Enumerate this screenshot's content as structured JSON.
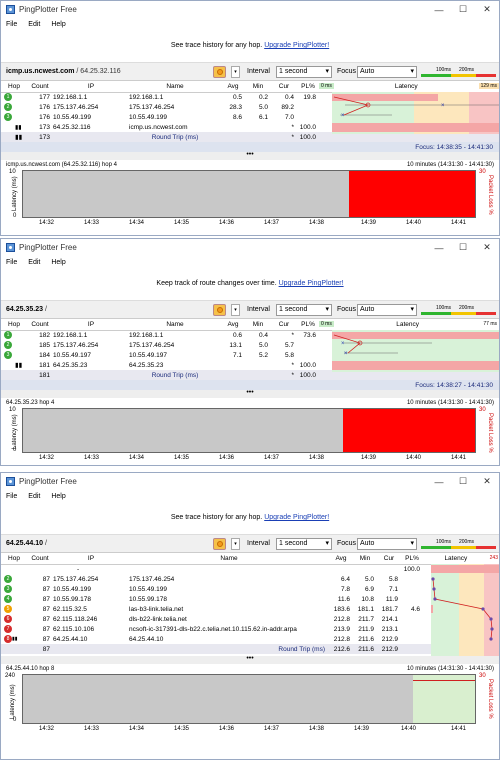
{
  "app_title": "PingPlotter Free",
  "menus": [
    "File",
    "Edit",
    "Help"
  ],
  "window_buttons": [
    "—",
    "☐",
    "✕"
  ],
  "upgrade_link": "Upgrade PingPlotter!",
  "interval_label": "Interval",
  "interval_value": "1 second",
  "focus_label": "Focus",
  "focus_value": "Auto",
  "scale": {
    "t1": "100ms",
    "t2": "200ms"
  },
  "headers": {
    "hop": "Hop",
    "count": "Count",
    "ip": "IP",
    "name": "Name",
    "avg": "Avg",
    "min": "Min",
    "cur": "Cur",
    "pl": "PL%",
    "latency": "Latency"
  },
  "round_trip": "Round Trip (ms)",
  "colors": {
    "good": "#3aa83a",
    "warn": "#f0a000",
    "bad": "#d62c2c",
    "red_fill": "#ff0000"
  },
  "windows": [
    {
      "banner": "See trace history for any hop.",
      "target_host": "icmp.us.ncwest.com",
      "target_ip": "/ 64.25.32.116",
      "lat_min_label": "0 ms",
      "lat_max_label": "129 ms",
      "hops": [
        {
          "hop": "1",
          "count": "177",
          "ip": "192.168.1.1",
          "name": "192.168.1.1",
          "avg": "0.5",
          "min": "0.2",
          "cur": "0.4",
          "pl": "19.8",
          "status": "good"
        },
        {
          "hop": "2",
          "count": "176",
          "ip": "175.137.46.254",
          "name": "175.137.46.254",
          "avg": "28.3",
          "min": "5.0",
          "cur": "89.2",
          "pl": "",
          "status": "good"
        },
        {
          "hop": "3",
          "count": "176",
          "ip": "10.55.49.199",
          "name": "10.55.49.199",
          "avg": "8.6",
          "min": "6.1",
          "cur": "7.0",
          "pl": "",
          "status": "good"
        },
        {
          "hop": "4",
          "count": "173",
          "ip": "64.25.32.116",
          "name": "icmp.us.ncwest.com",
          "avg": "",
          "min": "",
          "cur": "*",
          "pl": "100.0",
          "status": "none"
        }
      ],
      "summary": {
        "count": "173",
        "avg": "",
        "min": "",
        "cur": "*",
        "pl": "100.0"
      },
      "focus_text": "Focus: 14:38:35 - 14:41:30",
      "graph_title": "icmp.us.ncwest.com (64.25.32.116) hop 4",
      "graph_range": "10 minutes (14:31:30 - 14:41:30)",
      "y_top": "10",
      "y_bottom": "0",
      "right_top": "30",
      "x_ticks": [
        "14:32",
        "14:33",
        "14:34",
        "14:35",
        "14:36",
        "14:37",
        "14:38",
        "14:39",
        "14:40",
        "14:41"
      ]
    },
    {
      "banner": "Keep track of route changes over time.",
      "target_host": "64.25.35.23",
      "target_ip": "/",
      "lat_min_label": "0 ms",
      "lat_max_label": "77 ms",
      "hops": [
        {
          "hop": "1",
          "count": "182",
          "ip": "192.168.1.1",
          "name": "192.168.1.1",
          "avg": "0.6",
          "min": "0.4",
          "cur": "*",
          "pl": "73.6",
          "status": "good"
        },
        {
          "hop": "2",
          "count": "185",
          "ip": "175.137.46.254",
          "name": "175.137.46.254",
          "avg": "13.1",
          "min": "5.0",
          "cur": "5.7",
          "pl": "",
          "status": "good"
        },
        {
          "hop": "3",
          "count": "184",
          "ip": "10.55.49.197",
          "name": "10.55.49.197",
          "avg": "7.1",
          "min": "5.2",
          "cur": "5.8",
          "pl": "",
          "status": "good"
        },
        {
          "hop": "4",
          "count": "181",
          "ip": "64.25.35.23",
          "name": "64.25.35.23",
          "avg": "",
          "min": "",
          "cur": "*",
          "pl": "100.0",
          "status": "none"
        }
      ],
      "summary": {
        "count": "181",
        "avg": "",
        "min": "",
        "cur": "*",
        "pl": "100.0"
      },
      "focus_text": "Focus: 14:38:27 - 14:41:30",
      "graph_title": "64.25.35.23 hop 4",
      "graph_range": "10 minutes (14:31:30 - 14:41:30)",
      "y_top": "10",
      "y_bottom": "0",
      "right_top": "30",
      "x_ticks": [
        "14:32",
        "14:33",
        "14:34",
        "14:35",
        "14:36",
        "14:37",
        "14:38",
        "14:39",
        "14:40",
        "14:41"
      ]
    },
    {
      "banner": "See trace history for any hop.",
      "target_host": "64.25.44.10",
      "target_ip": "/",
      "lat_min_label": "",
      "lat_max_label": "243",
      "hops": [
        {
          "hop": "1",
          "count": "",
          "ip": "-",
          "name": "",
          "avg": "",
          "min": "",
          "cur": "",
          "pl": "100.0",
          "status": "none"
        },
        {
          "hop": "2",
          "count": "87",
          "ip": "175.137.46.254",
          "name": "175.137.46.254",
          "avg": "6.4",
          "min": "5.0",
          "cur": "5.8",
          "pl": "",
          "status": "good"
        },
        {
          "hop": "3",
          "count": "87",
          "ip": "10.55.49.199",
          "name": "10.55.49.199",
          "avg": "7.8",
          "min": "6.9",
          "cur": "7.1",
          "pl": "",
          "status": "good"
        },
        {
          "hop": "4",
          "count": "87",
          "ip": "10.55.99.178",
          "name": "10.55.99.178",
          "avg": "11.6",
          "min": "10.8",
          "cur": "11.9",
          "pl": "",
          "status": "good"
        },
        {
          "hop": "5",
          "count": "87",
          "ip": "62.115.32.5",
          "name": "las-b3-link.telia.net",
          "avg": "183.6",
          "min": "181.1",
          "cur": "181.7",
          "pl": "4.6",
          "status": "warn"
        },
        {
          "hop": "6",
          "count": "87",
          "ip": "62.115.118.246",
          "name": "dls-b22-link.telia.net",
          "avg": "212.8",
          "min": "211.7",
          "cur": "214.1",
          "pl": "",
          "status": "bad"
        },
        {
          "hop": "7",
          "count": "87",
          "ip": "62.115.10.106",
          "name": "ncsoft-ic-317391-dls-b22.c.telia.net.10.115.62.in-addr.arpa",
          "avg": "213.9",
          "min": "211.9",
          "cur": "213.1",
          "pl": "",
          "status": "bad"
        },
        {
          "hop": "8",
          "count": "87",
          "ip": "64.25.44.10",
          "name": "64.25.44.10",
          "avg": "212.8",
          "min": "211.6",
          "cur": "212.9",
          "pl": "",
          "status": "bad"
        }
      ],
      "summary": {
        "count": "87",
        "avg": "212.6",
        "min": "211.6",
        "cur": "212.9",
        "pl": ""
      },
      "focus_text": "",
      "graph_title": "64.25.44.10 hop 8",
      "graph_range": "10 minutes (14:31:30 - 14:41:30)",
      "y_top": "240",
      "y_bottom": "0",
      "right_top": "30",
      "x_ticks": [
        "14:32",
        "14:33",
        "14:34",
        "14:35",
        "14:36",
        "14:37",
        "14:38",
        "14:39",
        "14:40",
        "14:41"
      ]
    }
  ],
  "axis_left": "Latency (ms)",
  "axis_right": "Packet Loss %",
  "splitter": "•••"
}
